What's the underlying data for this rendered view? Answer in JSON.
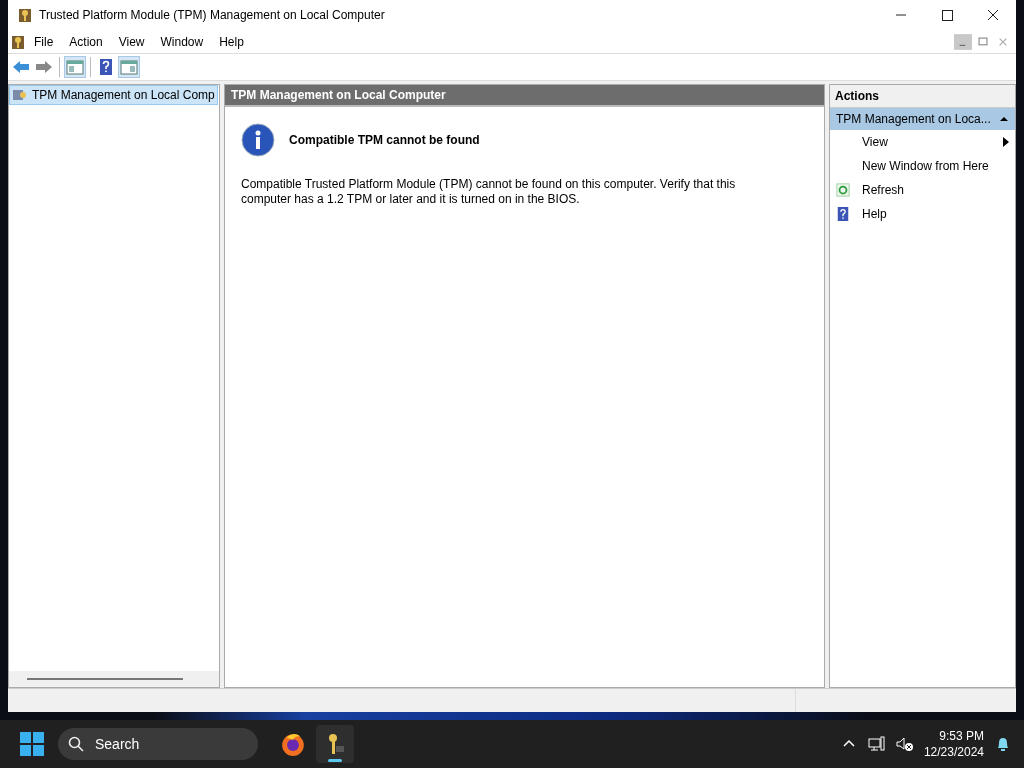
{
  "window": {
    "title": "Trusted Platform Module (TPM) Management on Local Computer"
  },
  "menu": [
    "File",
    "Action",
    "View",
    "Window",
    "Help"
  ],
  "tree": [
    {
      "label": "TPM Management on Local Comp",
      "selected": true
    }
  ],
  "content": {
    "header": "TPM Management on Local Computer",
    "heading": "Compatible TPM cannot be found",
    "message": "Compatible Trusted Platform Module (TPM) cannot be found on this computer. Verify that this computer has a 1.2 TPM or later and it is turned on in the BIOS."
  },
  "actions": {
    "title": "Actions",
    "section": {
      "label": "TPM Management on Loca...",
      "expanded": true
    },
    "items": [
      {
        "label": "View",
        "kind": "submenu"
      },
      {
        "label": "New Window from Here",
        "kind": "plain"
      },
      {
        "label": "Refresh",
        "kind": "refresh"
      },
      {
        "label": "Help",
        "kind": "help"
      }
    ]
  },
  "taskbar": {
    "search": {
      "placeholder": "Search"
    },
    "time": "9:53 PM",
    "date": "12/23/2024"
  }
}
